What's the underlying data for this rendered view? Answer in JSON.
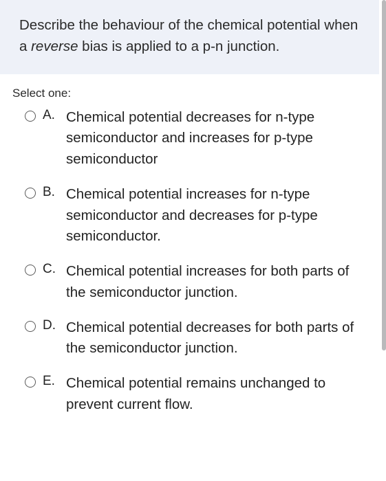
{
  "question": {
    "prefix": "Describe the behaviour of the chemical potential when a ",
    "italic": "reverse",
    "suffix": " bias is applied to a p-n junction."
  },
  "select_one_label": "Select one:",
  "options": [
    {
      "letter": "A.",
      "text": "Chemical potential decreases for n-type semiconductor and increases for p-type semiconductor"
    },
    {
      "letter": "B.",
      "text": "Chemical potential increases for n-type semiconductor and decreases for p-type semiconductor."
    },
    {
      "letter": "C.",
      "text": "Chemical potential increases for both parts of the semiconductor junction."
    },
    {
      "letter": "D.",
      "text": "Chemical potential decreases for both parts of the semiconductor junction."
    },
    {
      "letter": "E.",
      "text": "Chemical potential remains unchanged to prevent current flow."
    }
  ]
}
